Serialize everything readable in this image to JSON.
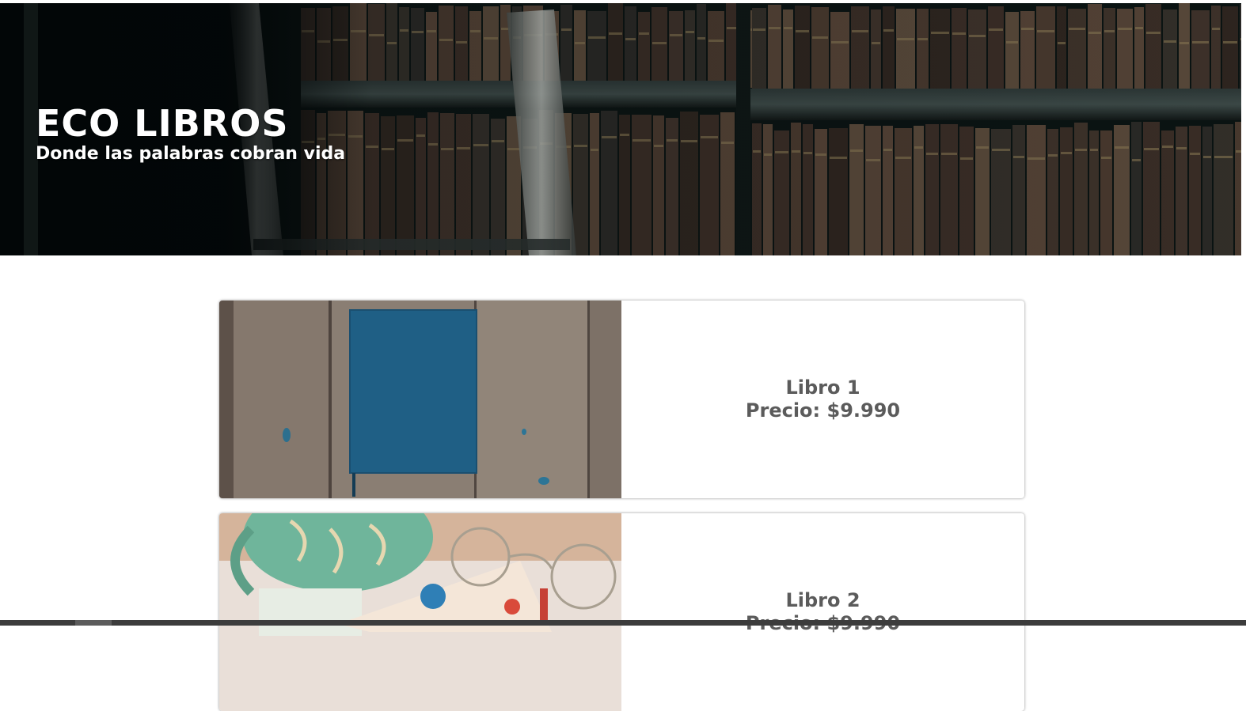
{
  "hero": {
    "title": "ECO LIBROS",
    "subtitle": "Donde las palabras cobran vida"
  },
  "books": [
    {
      "name": "Libro 1",
      "price": "Precio: $9.990"
    },
    {
      "name": "Libro 2",
      "price": "Precio: $9.990"
    }
  ],
  "colors": {
    "hero_bg": "#07100f",
    "card_text": "#5b5b5b",
    "book_cover": "#1f5f85",
    "wood": "#7d7066",
    "mug": "#6fb59b"
  }
}
